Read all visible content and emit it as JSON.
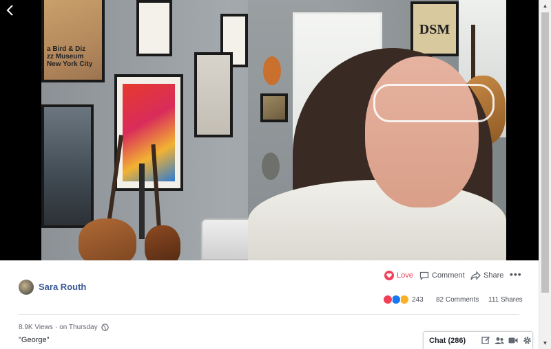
{
  "video": {
    "back_icon": "chevron-left-icon",
    "poster_text": [
      "a Bird & Diz",
      "zz Museum",
      "New York City"
    ],
    "poster_dsm_text": "DSM"
  },
  "post": {
    "page_name": "Sara Routh",
    "actions": {
      "love_label": "Love",
      "comment_label": "Comment",
      "share_label": "Share",
      "more_label": "•••"
    },
    "reaction_count": "243",
    "comments_count": "82 Comments",
    "shares_count": "111 Shares",
    "views": "8.9K Views",
    "separator": "·",
    "posted": "on Thursday",
    "caption": "\"George\""
  },
  "chat": {
    "label": "Chat (286)",
    "icons": [
      "compose-icon",
      "people-icon",
      "video-call-icon",
      "gear-icon"
    ]
  },
  "colors": {
    "link_blue": "#385898",
    "love_red": "#f33e58",
    "like_blue": "#1877f2",
    "care_yellow": "#f7b125"
  }
}
